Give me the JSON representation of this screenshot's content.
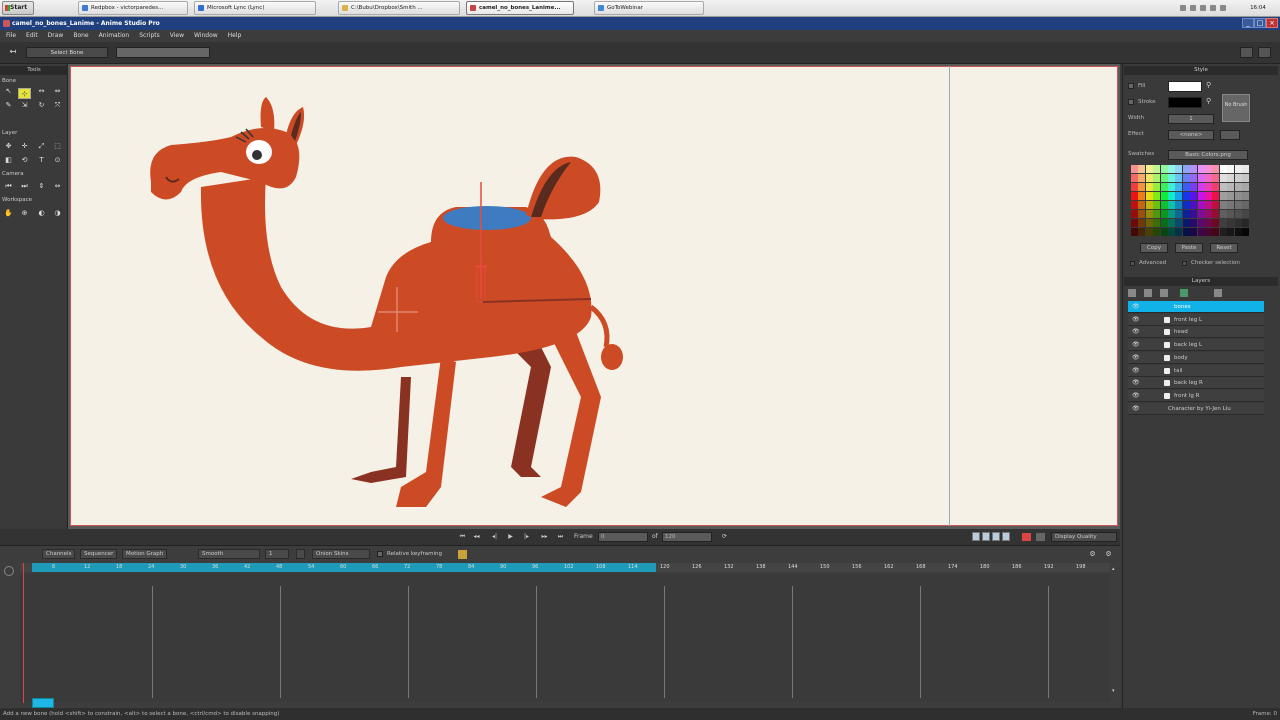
{
  "taskbar": {
    "start_label": "Start",
    "tasks": [
      {
        "label": "Redpbox - victorparedes...",
        "color": "#3b7ad8"
      },
      {
        "label": "Microsoft Lync (Lync)",
        "color": "#2f6fd1"
      },
      {
        "label": "C:\\Bubu\\Dropbox\\Smith ...",
        "color": "#d9b44a"
      },
      {
        "label": "camel_no_bones_Lanime...",
        "color": "#c84545",
        "active": true
      },
      {
        "label": "GoToWebinar",
        "color": "#3c8ad9"
      }
    ],
    "clock": "16:04"
  },
  "window": {
    "title": "camel_no_bones_Lanime - Anime Studio Pro",
    "min_label": "_",
    "max_label": "□",
    "close_label": "×"
  },
  "menu": [
    "File",
    "Edit",
    "Draw",
    "Bone",
    "Animation",
    "Scripts",
    "View",
    "Window",
    "Help"
  ],
  "tool_options": {
    "button_label": "Select Bone"
  },
  "toolbox": {
    "title": "Tools",
    "sections": [
      {
        "label": "Bone"
      },
      {
        "label": "Layer"
      },
      {
        "label": "Camera"
      },
      {
        "label": "Workspace"
      }
    ],
    "icons": [
      "↖",
      "⊹",
      "↔",
      "⇔",
      "✎",
      "⇲",
      "↻",
      "⤧",
      "✥",
      "✛",
      "⤢",
      "⬚",
      "◧",
      "⟲",
      "T",
      "⊙",
      "⏮",
      "⏭",
      "⇕",
      "⇔",
      "✋",
      "⊕",
      "◐",
      "◑"
    ]
  },
  "playback": {
    "frame_label": "Frame",
    "frame_value": "0",
    "of_label": "of",
    "of_value": "120",
    "display_quality": "Display Quality"
  },
  "timeline": {
    "tabs": [
      "Channels",
      "Sequencer",
      "Motion Graph"
    ],
    "smooth_label": "Smooth",
    "smooth_value": "1",
    "onion_label": "Onion Skins",
    "relative_label": "Relative keyframing",
    "ruler": [
      "6",
      "12",
      "18",
      "24",
      "30",
      "36",
      "42",
      "48",
      "54",
      "60",
      "66",
      "72",
      "78",
      "84",
      "90",
      "96",
      "102",
      "108",
      "114",
      "120",
      "126",
      "132",
      "138",
      "144",
      "150",
      "156",
      "162",
      "168",
      "174",
      "180",
      "186",
      "192",
      "198"
    ]
  },
  "status": {
    "text": "Add a new bone (hold <shift> to constrain, <alt> to select a bone, <ctrl/cmd> to disable snapping)",
    "right": "Frame: 0"
  },
  "style_panel": {
    "title": "Style",
    "fill_label": "Fill",
    "stroke_label": "Stroke",
    "width_label": "Width",
    "width_value": "1",
    "effect_label": "Effect",
    "effect_value": "<none>",
    "no_brush_label": "No Brush",
    "swatches_label": "Swatches",
    "swatches_file": "Basic Colors.png",
    "copy_label": "Copy",
    "paste_label": "Paste",
    "reset_label": "Reset",
    "advanced_label": "Advanced",
    "checker_label": "Checker selection",
    "fill_color": "#ffffff",
    "stroke_color": "#000000"
  },
  "layers_panel": {
    "title": "Layers",
    "layers": [
      {
        "name": "bones",
        "selected": true
      },
      {
        "name": "front leg L"
      },
      {
        "name": "head"
      },
      {
        "name": "back leg L"
      },
      {
        "name": "body"
      },
      {
        "name": "tail"
      },
      {
        "name": "back leg R"
      },
      {
        "name": "front lg R"
      },
      {
        "name": "Character by Yi-Jen Liu"
      }
    ]
  },
  "colors": {
    "camel_body": "#cc4a24",
    "camel_dark": "#8a3222",
    "saddle": "#3f7bc0",
    "bone_red": "#e84b3c",
    "accent": "#10b2e8"
  }
}
